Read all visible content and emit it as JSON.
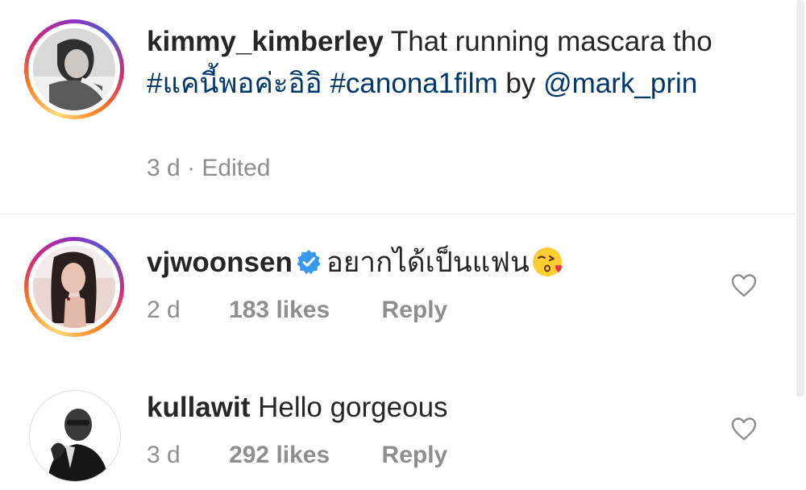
{
  "caption": {
    "username": "kimmy_kimberley",
    "text_part1": "That running mascara tho",
    "hashtag1": "#แคนี้พอค่ะอิอิ",
    "hashtag2": "#canona1film",
    "text_part2": "by",
    "mention": "@mark_prin",
    "time": "3 d",
    "separator": "·",
    "edited": "Edited"
  },
  "comments": [
    {
      "username": "vjwoonsen",
      "verified": true,
      "text": "อยากได้เป็นแฟน",
      "emoji": "kissing-heart-emoji",
      "time": "2 d",
      "likes": "183 likes",
      "reply": "Reply",
      "story_ring": true
    },
    {
      "username": "kullawit",
      "verified": false,
      "text": "Hello gorgeous",
      "time": "3 d",
      "likes": "292 likes",
      "reply": "Reply",
      "story_ring": false
    }
  ],
  "colors": {
    "text": "#262626",
    "link": "#00376b",
    "meta": "#8e8e8e",
    "verified": "#3897f0",
    "divider": "#e6e6e6"
  }
}
